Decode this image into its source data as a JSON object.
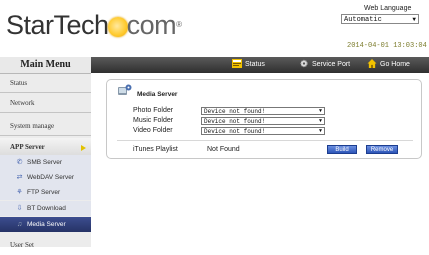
{
  "header": {
    "logo_text_1": "StarTech",
    "logo_text_2": "com",
    "web_language_label": "Web Language",
    "language_selected": "Automatic",
    "datetime": "2014-04-01 13:03:04"
  },
  "topbar": {
    "status_label": "Status",
    "service_port_label": "Service Port",
    "go_home_label": "Go Home"
  },
  "sidebar": {
    "title": "Main Menu",
    "items": [
      {
        "label": "Status"
      },
      {
        "label": "Network"
      },
      {
        "label": "System manage"
      },
      {
        "label": "APP Server"
      },
      {
        "label": "User Set"
      }
    ],
    "sub_items": [
      {
        "label": "SMB Server",
        "icon": "smb-icon"
      },
      {
        "label": "WebDAV Server",
        "icon": "webdav-icon"
      },
      {
        "label": "FTP Server",
        "icon": "ftp-icon"
      },
      {
        "label": "BT Download",
        "icon": "bt-download-icon"
      },
      {
        "label": "Media Server",
        "icon": "media-server-icon"
      }
    ]
  },
  "media_server": {
    "title": "Media Server",
    "photo_folder_label": "Photo Folder",
    "photo_folder_value": "Device not found!",
    "music_folder_label": "Music Folder",
    "music_folder_value": "Device not found!",
    "video_folder_label": "Video Folder",
    "video_folder_value": "Device not found!",
    "itunes_label": "iTunes Playlist",
    "itunes_value": "Not Found",
    "build_label": "Build",
    "remove_label": "Remove"
  },
  "colors": {
    "accent_blue": "#2d55b8",
    "active_menu": "#263366",
    "topbar": "#3a3a3a"
  }
}
